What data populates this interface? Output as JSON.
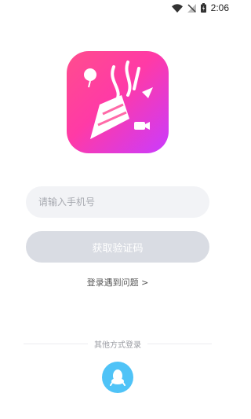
{
  "status_bar": {
    "time": "2:06",
    "icons": [
      "wifi-icon",
      "signal-off-icon",
      "battery-icon"
    ]
  },
  "app_logo": {
    "icon": "party-popper-icon",
    "colors": [
      "#ff4d8d",
      "#c93bff"
    ]
  },
  "login_form": {
    "phone_placeholder": "请输入手机号",
    "phone_value": "",
    "get_code_label": "获取验证码",
    "help_link": "登录遇到问题 >"
  },
  "other_login": {
    "divider_label": "其他方式登录",
    "methods": [
      {
        "icon": "qq-penguin-icon",
        "color": "#4fc3f7"
      }
    ]
  }
}
